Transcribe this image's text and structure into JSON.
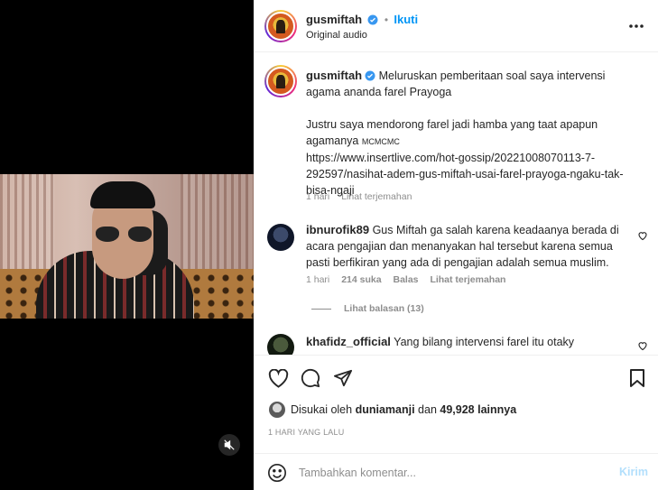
{
  "video": {
    "mute_icon": "muted-speaker-icon"
  },
  "post": {
    "username": "gusmiftah",
    "separator": "•",
    "follow_label": "Ikuti",
    "audio_label": "Original audio",
    "more_icon": "more-horizontal-icon"
  },
  "caption": {
    "username": "gusmiftah",
    "text_line1": "Meluruskan pemberitaan soal saya intervensi",
    "text_line2": "agama ananda farel Prayoga",
    "para2_line1": "Justru saya mendorong farel jadi hamba yang taat apapun",
    "para2_line2": "agamanya",
    "para2_tag": "MCMCMC",
    "url_line1": "https://www.insertlive.com/hot-gossip/20221008070113-7-",
    "url_line2": "292597/nasihat-adem-gus-miftah-usai-farel-prayoga-ngaku-tak-",
    "url_line3": "bisa-ngaji",
    "time": "1 hari",
    "translate": "Lihat terjemahan"
  },
  "comments": [
    {
      "username": "ibnurofik89",
      "line1": "Gus Miftah ga salah karena keadaanya berada di",
      "line2": "acara pengajian dan menanyakan hal tersebut karena semua",
      "line3": "pasti berfikiran yang ada di pengajian adalah semua muslim.",
      "time": "1 hari",
      "likes": "214 suka",
      "reply": "Balas",
      "translate": "Lihat terjemahan",
      "view_replies": "Lihat balasan (13)"
    },
    {
      "username": "khafidz_official",
      "line1": "Yang bilang intervensi farel itu otaky"
    }
  ],
  "actions": {
    "liked_by_prefix": "Disukai oleh",
    "liked_by_user": "duniamanji",
    "liked_by_and": "dan",
    "liked_by_count": "49,928 lainnya",
    "date": "1 HARI YANG LALU"
  },
  "add_comment": {
    "placeholder": "Tambahkan komentar...",
    "post_label": "Kirim"
  },
  "colors": {
    "link": "#0095f6",
    "muted": "#8e8e8e",
    "text": "#262626",
    "verified": "#3897f0"
  }
}
